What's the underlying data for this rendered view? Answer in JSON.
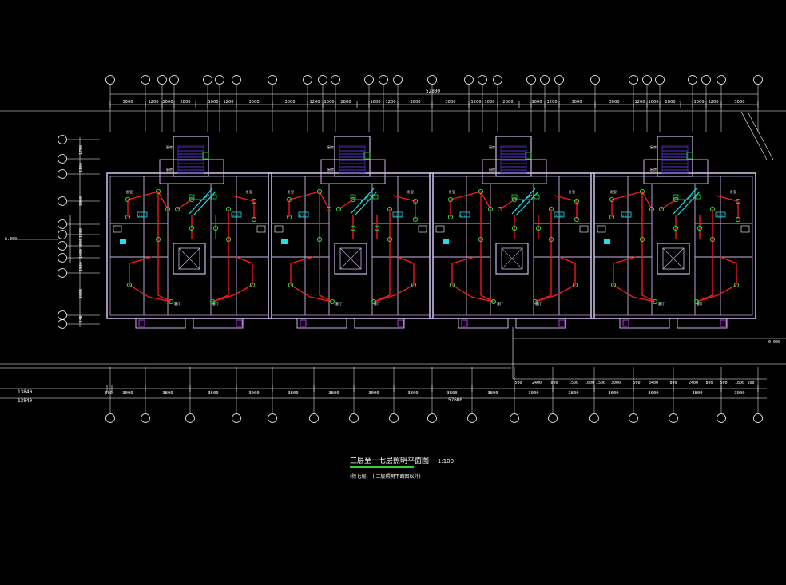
{
  "drawing": {
    "title": "三层至十七层照明平面图",
    "scale": "1:100",
    "subtitle": "(除七层、十三层照明平面图以外)",
    "total_width_top": "52800",
    "total_width_bottom": "57600",
    "left_dims": [
      "13840",
      "13840"
    ],
    "elev_left": "h.300",
    "elev_right": "0.000"
  },
  "top_dims": [
    "3000",
    "1200",
    "1000",
    "2800",
    "1000",
    "1200",
    "3000",
    "3000",
    "1200",
    "1000",
    "2800",
    "1000",
    "1200",
    "3000",
    "3000",
    "1200",
    "1000",
    "2800",
    "1000",
    "1200",
    "3000",
    "3000",
    "1200",
    "1000",
    "2800",
    "1000",
    "1200",
    "3000"
  ],
  "bottom_dims": [
    "300",
    "3000",
    "3800",
    "3600",
    "3000",
    "3800",
    "3800",
    "3000",
    "3800",
    "3800",
    "2400",
    "800",
    "1500",
    "1000",
    "1500",
    "3000",
    "3400",
    "800",
    "2400",
    "800",
    "1800",
    "3000"
  ],
  "left_vdims": [
    "1750",
    "1300",
    "3000",
    "1550",
    "1000",
    "1000",
    "1500",
    "3000",
    "240"
  ],
  "room_labels": [
    "卧室",
    "卧室",
    "卧室",
    "卧室",
    "客厅",
    "客厅",
    "客厅",
    "客厅",
    "餐厅",
    "餐厅",
    "厨房",
    "厨房",
    "卫生间",
    "卫生间"
  ],
  "panel_labels": [
    "AL1a",
    "AL1b",
    "AL1a",
    "AL1b",
    "AL1a",
    "AL1b",
    "AL1a",
    "AL1b"
  ],
  "colors": {
    "background": "#000000",
    "wall": "#c9b6e6",
    "dim_line": "#ffffff",
    "wire": "#ff1a1a",
    "fixture": "#2ed13b",
    "panel": "#1ee0e6",
    "stair": "#5b2fd1",
    "grid": "#ffffff"
  }
}
